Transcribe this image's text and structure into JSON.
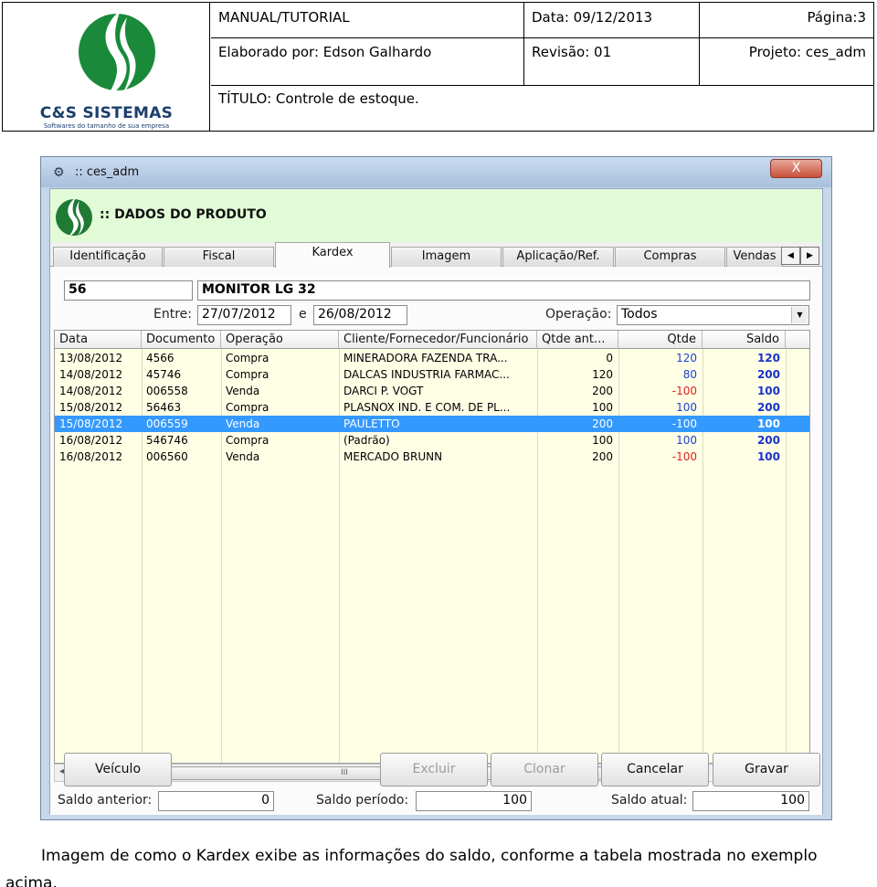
{
  "header": {
    "company_name": "C&S SISTEMAS",
    "company_slogan": "Softwares do tamanho de sua empresa",
    "doc_type": "MANUAL/TUTORIAL",
    "date": "Data: 09/12/2013",
    "page": "Página:3",
    "author": "Elaborado por: Edson Galhardo",
    "revision": "Revisão: 01",
    "project": "Projeto: ces_adm",
    "title": "TÍTULO: Controle de estoque."
  },
  "window": {
    "title": ":: ces_adm",
    "close_label": "X",
    "section_title": ":: DADOS DO PRODUTO",
    "tabs": [
      {
        "label": "Identificação"
      },
      {
        "label": "Fiscal"
      },
      {
        "label": "Kardex"
      },
      {
        "label": "Imagem"
      },
      {
        "label": "Aplicação/Ref."
      },
      {
        "label": "Compras"
      },
      {
        "label": "Vendas"
      }
    ],
    "active_tab": "Kardex",
    "tab_arrow_left": "◀",
    "tab_arrow_right": "▶"
  },
  "kardex": {
    "product_code": "56",
    "product_name": "MONITOR LG 32",
    "between_label": "Entre:",
    "date_from": "27/07/2012",
    "and_label": "e",
    "date_to": "26/08/2012",
    "operation_label": "Operação:",
    "operation_value": "Todos",
    "columns": [
      "Data",
      "Documento",
      "Operação",
      "Cliente/Fornecedor/Funcionário",
      "Qtde ant...",
      "Qtde",
      "Saldo"
    ],
    "rows": [
      {
        "data": "13/08/2012",
        "documento": "4566",
        "operacao": "Compra",
        "cliente": "MINERADORA FAZENDA TRA...",
        "qtde_ant": "0",
        "qtde": "120",
        "saldo": "120",
        "selected": false
      },
      {
        "data": "14/08/2012",
        "documento": "45746",
        "operacao": "Compra",
        "cliente": "DALCAS INDUSTRIA FARMAC...",
        "qtde_ant": "120",
        "qtde": "80",
        "saldo": "200",
        "selected": false
      },
      {
        "data": "14/08/2012",
        "documento": "006558",
        "operacao": "Venda",
        "cliente": "DARCI P. VOGT",
        "qtde_ant": "200",
        "qtde": "-100",
        "saldo": "100",
        "selected": false
      },
      {
        "data": "15/08/2012",
        "documento": "56463",
        "operacao": "Compra",
        "cliente": "PLASNOX IND. E COM. DE PL...",
        "qtde_ant": "100",
        "qtde": "100",
        "saldo": "200",
        "selected": false
      },
      {
        "data": "15/08/2012",
        "documento": "006559",
        "operacao": "Venda",
        "cliente": "PAULETTO",
        "qtde_ant": "200",
        "qtde": "-100",
        "saldo": "100",
        "selected": true
      },
      {
        "data": "16/08/2012",
        "documento": "546746",
        "operacao": "Compra",
        "cliente": "(Padrão)",
        "qtde_ant": "100",
        "qtde": "100",
        "saldo": "200",
        "selected": false
      },
      {
        "data": "16/08/2012",
        "documento": "006560",
        "operacao": "Venda",
        "cliente": "MERCADO BRUNN",
        "qtde_ant": "200",
        "qtde": "-100",
        "saldo": "100",
        "selected": false
      }
    ],
    "scroll_grip": "III",
    "saldo_anterior_label": "Saldo anterior:",
    "saldo_anterior": "0",
    "saldo_periodo_label": "Saldo período:",
    "saldo_periodo": "100",
    "saldo_atual_label": "Saldo atual:",
    "saldo_atual": "100"
  },
  "buttons": {
    "veiculo": "Veículo",
    "excluir": "Excluir",
    "clonar": "Clonar",
    "cancelar": "Cancelar",
    "gravar": "Gravar"
  },
  "caption": "Imagem de como o Kardex exibe as informações do saldo, conforme a tabela mostrada no exemplo acima.",
  "colors": {
    "logo_green": "#1a8a3a",
    "logo_blue": "#1c3f6e",
    "selection_blue": "#3399ff",
    "negative_red": "#e02020",
    "saldo_blue": "#1933c8",
    "grid_bg": "#ffffe6",
    "product_header_bg": "#e2fbd7"
  },
  "icons": {
    "logo": "green-swirl-logo-icon",
    "window_icon": "gear-icon",
    "dropdown": "chevron-down-icon"
  }
}
